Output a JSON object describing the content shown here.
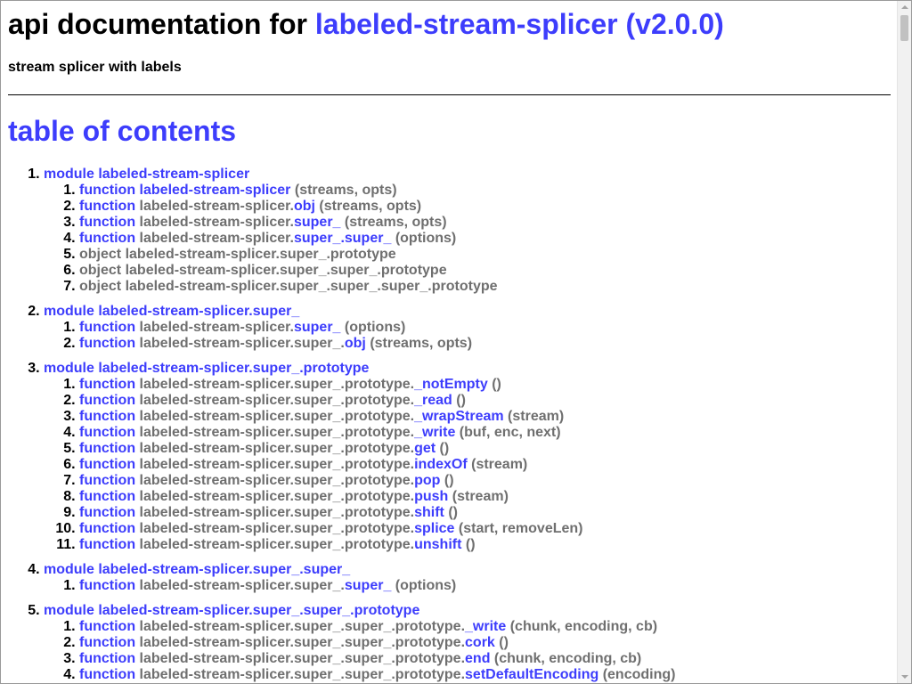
{
  "header": {
    "title_prefix": "api documentation for",
    "package_link": "labeled-stream-splicer (v2.0.0)",
    "description": "stream splicer with labels"
  },
  "toc": {
    "heading": "table of contents",
    "modules": [
      {
        "label": "module labeled-stream-splicer",
        "items": [
          {
            "kind": "function",
            "prefix": "",
            "name": "labeled-stream-splicer",
            "args": "(streams, opts)"
          },
          {
            "kind": "function",
            "prefix": "labeled-stream-splicer.",
            "name": "obj",
            "args": "(streams, opts)"
          },
          {
            "kind": "function",
            "prefix": "labeled-stream-splicer.",
            "name": "super_",
            "args": "(streams, opts)"
          },
          {
            "kind": "function",
            "prefix": "labeled-stream-splicer.",
            "name": "super_.super_",
            "args": "(options)"
          },
          {
            "kind": "object",
            "prefix": "labeled-stream-splicer.super_.prototype",
            "name": "",
            "args": ""
          },
          {
            "kind": "object",
            "prefix": "labeled-stream-splicer.super_.super_.prototype",
            "name": "",
            "args": ""
          },
          {
            "kind": "object",
            "prefix": "labeled-stream-splicer.super_.super_.super_.prototype",
            "name": "",
            "args": ""
          }
        ]
      },
      {
        "label": "module labeled-stream-splicer.super_",
        "items": [
          {
            "kind": "function",
            "prefix": "labeled-stream-splicer.",
            "name": "super_",
            "args": "(options)"
          },
          {
            "kind": "function",
            "prefix": "labeled-stream-splicer.super_.",
            "name": "obj",
            "args": "(streams, opts)"
          }
        ]
      },
      {
        "label": "module labeled-stream-splicer.super_.prototype",
        "items": [
          {
            "kind": "function",
            "prefix": "labeled-stream-splicer.super_.prototype.",
            "name": "_notEmpty",
            "args": "()"
          },
          {
            "kind": "function",
            "prefix": "labeled-stream-splicer.super_.prototype.",
            "name": "_read",
            "args": "()"
          },
          {
            "kind": "function",
            "prefix": "labeled-stream-splicer.super_.prototype.",
            "name": "_wrapStream",
            "args": "(stream)"
          },
          {
            "kind": "function",
            "prefix": "labeled-stream-splicer.super_.prototype.",
            "name": "_write",
            "args": "(buf, enc, next)"
          },
          {
            "kind": "function",
            "prefix": "labeled-stream-splicer.super_.prototype.",
            "name": "get",
            "args": "()"
          },
          {
            "kind": "function",
            "prefix": "labeled-stream-splicer.super_.prototype.",
            "name": "indexOf",
            "args": "(stream)"
          },
          {
            "kind": "function",
            "prefix": "labeled-stream-splicer.super_.prototype.",
            "name": "pop",
            "args": "()"
          },
          {
            "kind": "function",
            "prefix": "labeled-stream-splicer.super_.prototype.",
            "name": "push",
            "args": "(stream)"
          },
          {
            "kind": "function",
            "prefix": "labeled-stream-splicer.super_.prototype.",
            "name": "shift",
            "args": "()"
          },
          {
            "kind": "function",
            "prefix": "labeled-stream-splicer.super_.prototype.",
            "name": "splice",
            "args": "(start, removeLen)"
          },
          {
            "kind": "function",
            "prefix": "labeled-stream-splicer.super_.prototype.",
            "name": "unshift",
            "args": "()"
          }
        ]
      },
      {
        "label": "module labeled-stream-splicer.super_.super_",
        "items": [
          {
            "kind": "function",
            "prefix": "labeled-stream-splicer.super_.",
            "name": "super_",
            "args": "(options)"
          }
        ]
      },
      {
        "label": "module labeled-stream-splicer.super_.super_.prototype",
        "items": [
          {
            "kind": "function",
            "prefix": "labeled-stream-splicer.super_.super_.prototype.",
            "name": "_write",
            "args": "(chunk, encoding, cb)"
          },
          {
            "kind": "function",
            "prefix": "labeled-stream-splicer.super_.super_.prototype.",
            "name": "cork",
            "args": "()"
          },
          {
            "kind": "function",
            "prefix": "labeled-stream-splicer.super_.super_.prototype.",
            "name": "end",
            "args": "(chunk, encoding, cb)"
          },
          {
            "kind": "function",
            "prefix": "labeled-stream-splicer.super_.super_.prototype.",
            "name": "setDefaultEncoding",
            "args": "(encoding)"
          }
        ]
      }
    ]
  },
  "colors": {
    "link": "#3d3dfc",
    "muted": "#6f6f6f"
  }
}
